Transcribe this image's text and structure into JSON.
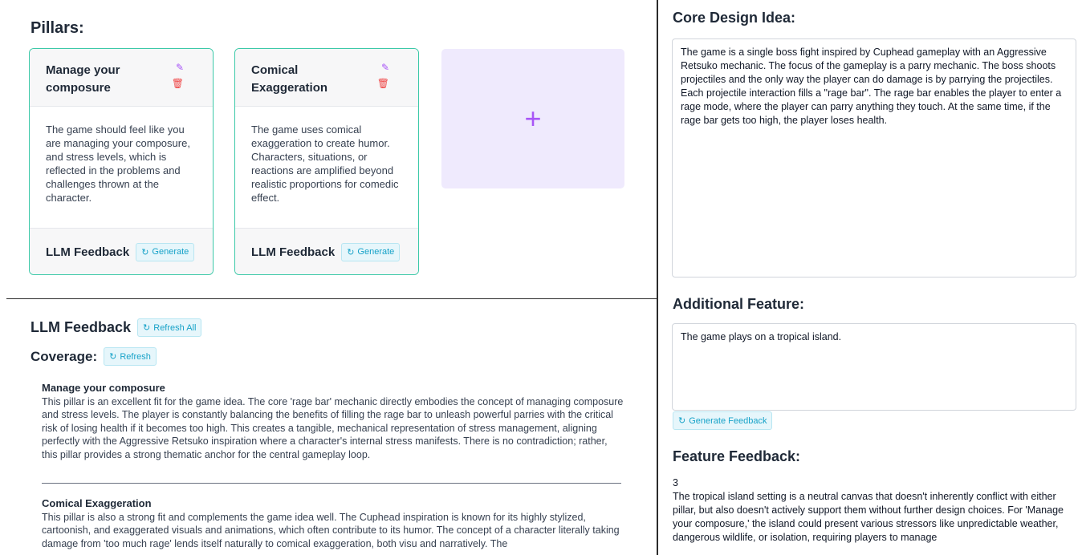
{
  "pillars": {
    "title": "Pillars:",
    "cards": [
      {
        "title": "Manage your composure",
        "description": "The game should feel like you are managing your composure, and stress levels, which is reflected in the problems and challenges thrown at the character.",
        "feedback_label": "LLM Feedback",
        "generate_label": "Generate"
      },
      {
        "title": "Comical Exaggeration",
        "description": "The game uses comical exaggeration to create humor. Characters, situations, or reactions are amplified beyond realistic proportions for comedic effect.",
        "feedback_label": "LLM Feedback",
        "generate_label": "Generate"
      }
    ],
    "add_symbol": "+"
  },
  "llm_feedback": {
    "title": "LLM Feedback",
    "refresh_all_label": "Refresh All",
    "coverage": {
      "title": "Coverage:",
      "refresh_label": "Refresh",
      "items": [
        {
          "name": "Manage your composure",
          "text": "This pillar is an excellent fit for the game idea. The core 'rage bar' mechanic directly embodies the concept of managing composure and stress levels. The player is constantly balancing the benefits of filling the rage bar to unleash powerful parries with the critical risk of losing health if it becomes too high. This creates a tangible, mechanical representation of stress management, aligning perfectly with the Aggressive Retsuko inspiration where a character's internal stress manifests. There is no contradiction; rather, this pillar provides a strong thematic anchor for the central gameplay loop."
        },
        {
          "name": "Comical Exaggeration",
          "text": "This pillar is also a strong fit and complements the game idea well. The Cuphead inspiration is known for its highly stylized, cartoonish, and exaggerated visuals and animations, which often contribute to its humor. The concept of a character literally taking damage from 'too much rage' lends itself naturally to comical exaggeration, both visu and narratively. The"
        }
      ]
    }
  },
  "core_design": {
    "title": "Core Design Idea:",
    "value": "The game is a single boss fight inspired by Cuphead gameplay with an Aggressive Retsuko mechanic. The focus of the gameplay is a parry mechanic. The boss shoots projectiles and the only way the player can do damage is by parrying the projectiles. Each projectile interaction fills a \"rage bar\". The rage bar enables the player to enter a rage mode, where the player can parry anything they touch. At the same time, if the rage bar gets too high, the player loses health."
  },
  "additional_feature": {
    "title": "Additional Feature:",
    "value": "The game plays on a tropical island.",
    "generate_label": "Generate Feedback"
  },
  "feature_feedback": {
    "title": "Feature Feedback:",
    "score": "3",
    "text": "The tropical island setting is a neutral canvas that doesn't inherently conflict with either pillar, but also doesn't actively support them without further design choices. For 'Manage your composure,' the island could present various stressors like unpredictable weather, dangerous wildlife, or isolation, requiring players to manage"
  },
  "colors": {
    "accent_green": "#3cc9a8",
    "accent_purple": "#a855f7",
    "button_blue": "#17a2c8",
    "danger_red": "#ef4444"
  }
}
